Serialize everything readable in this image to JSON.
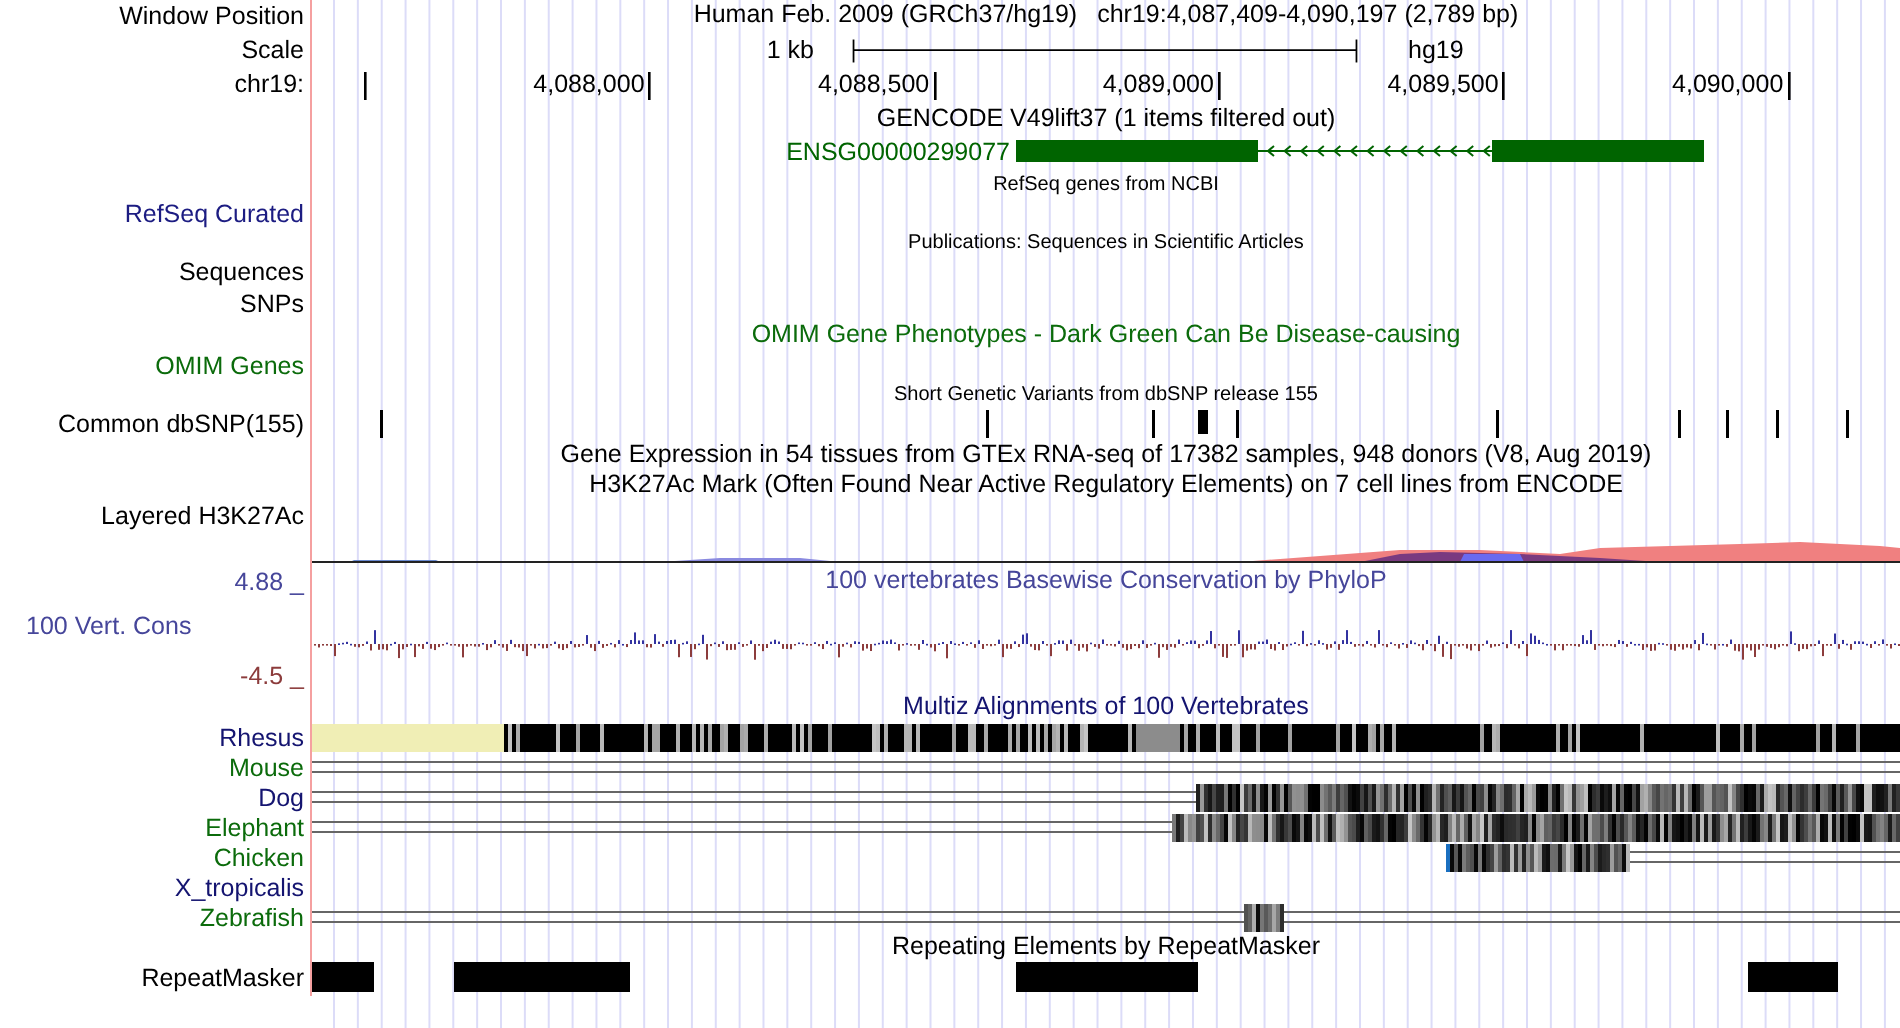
{
  "rows": [
    {
      "kind": "position",
      "label": "Window Position",
      "assembly": "Human Feb. 2009 (GRCh37/hg19)",
      "position": "chr19:4,087,409-4,090,197 (2,789 bp)"
    },
    {
      "kind": "scale",
      "label": "Scale",
      "scale_text": "1 kb",
      "assembly": "hg19"
    },
    {
      "kind": "ruler",
      "label": "chr19:",
      "ticks": [
        "4,088,000",
        "4,088,500",
        "4,089,000",
        "4,089,500",
        "4,090,000"
      ]
    },
    {
      "kind": "title",
      "title": "GENCODE V49lift37 (1 items filtered out)"
    },
    {
      "kind": "gene",
      "gene": "ENSG00000299077",
      "color": "#006400"
    },
    {
      "kind": "caption",
      "title": "RefSeq genes from NCBI"
    },
    {
      "kind": "label",
      "label": "RefSeq Curated",
      "color": "#1c1c82"
    },
    {
      "kind": "caption",
      "title": "Publications: Sequences in Scientific Articles"
    },
    {
      "kind": "label",
      "label": "Sequences"
    },
    {
      "kind": "label",
      "label": "SNPs"
    },
    {
      "kind": "title",
      "title": "OMIM Gene Phenotypes - Dark Green Can Be Disease-causing",
      "color": "#0b6b0b"
    },
    {
      "kind": "label",
      "label": "OMIM Genes",
      "color": "#0b6b0b"
    },
    {
      "kind": "caption",
      "title": "Short Genetic Variants from dbSNP release 155"
    },
    {
      "kind": "snp",
      "label": "Common dbSNP(155)"
    },
    {
      "kind": "title",
      "title": "Gene Expression in 54 tissues from GTEx RNA-seq of 17382 samples, 948 donors (V8, Aug 2019)"
    },
    {
      "kind": "title",
      "title": "H3K27Ac Mark (Often Found Near Active Regulatory Elements) on 7 cell lines from ENCODE"
    },
    {
      "kind": "label",
      "label": "Layered H3K27Ac"
    },
    {
      "kind": "layered"
    },
    {
      "kind": "wig_top",
      "label": "4.88 _",
      "title": "100 vertebrates Basewise Conservation by PhyloP",
      "color": "#46469a"
    },
    {
      "kind": "wig",
      "label": "100 Vert. Cons",
      "color": "#46469a"
    },
    {
      "kind": "wig_bottom",
      "label": "-4.5 _",
      "color": "#8c3c3c"
    },
    {
      "kind": "title",
      "title": "Multiz Alignments of 100 Vertebrates",
      "color": "#141470"
    },
    {
      "kind": "species",
      "label": "Rhesus",
      "color": "#141470"
    },
    {
      "kind": "species",
      "label": "Mouse",
      "color": "#0b6b0b"
    },
    {
      "kind": "species",
      "label": "Dog",
      "color": "#141470"
    },
    {
      "kind": "species",
      "label": "Elephant",
      "color": "#0b6b0b"
    },
    {
      "kind": "species",
      "label": "Chicken",
      "color": "#0b6b0b"
    },
    {
      "kind": "species",
      "label": "X_tropicalis",
      "color": "#141470"
    },
    {
      "kind": "species",
      "label": "Zebrafish",
      "color": "#0b6b0b"
    },
    {
      "kind": "title",
      "title": "Repeating Elements by RepeatMasker"
    },
    {
      "kind": "repeats",
      "label": "RepeatMasker"
    }
  ]
}
